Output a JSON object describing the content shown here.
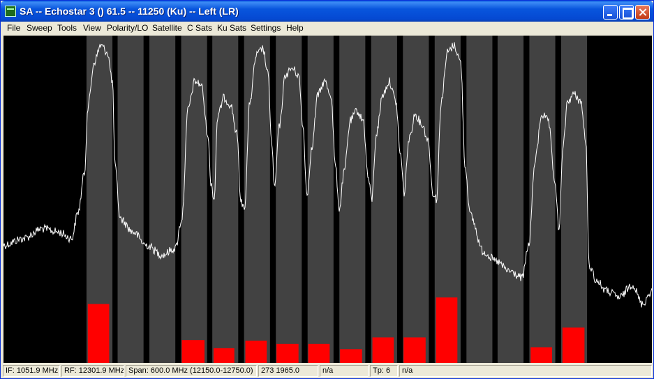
{
  "window": {
    "title": "SA -- Echostar 3 () 61.5 -- 11250 (Ku) -- Left (LR)"
  },
  "menu": [
    "File",
    "Sweep",
    "Tools",
    "View",
    "Polarity/LO",
    "Satellite",
    "C Sats",
    "Ku Sats",
    "Settings",
    "Help"
  ],
  "status": {
    "if": "IF: 1051.9 MHz",
    "rf": "RF: 12301.9 MHz",
    "span": "Span: 600.0 MHz (12150.0-12750.0)",
    "coord": "273 1965.0",
    "field5": "n/a",
    "tp": "Tp: 6",
    "field7": "n/a"
  },
  "colors": {
    "background": "#000000",
    "channel_band": "#424242",
    "trace": "#ffffff",
    "level_bar": "#ff0000"
  },
  "chart_data": {
    "type": "line",
    "title": "",
    "xlabel": "",
    "ylabel": "",
    "x_range_mhz": [
      12150.0,
      12750.0
    ],
    "y_range": [
      0,
      1
    ],
    "trace": [
      [
        0.0,
        0.36
      ],
      [
        0.03,
        0.38
      ],
      [
        0.06,
        0.41
      ],
      [
        0.085,
        0.4
      ],
      [
        0.105,
        0.38
      ],
      [
        0.115,
        0.46
      ],
      [
        0.125,
        0.58
      ],
      [
        0.13,
        0.78
      ],
      [
        0.14,
        0.92
      ],
      [
        0.15,
        0.97
      ],
      [
        0.16,
        0.95
      ],
      [
        0.168,
        0.86
      ],
      [
        0.172,
        0.6
      ],
      [
        0.18,
        0.44
      ],
      [
        0.2,
        0.4
      ],
      [
        0.22,
        0.36
      ],
      [
        0.245,
        0.33
      ],
      [
        0.265,
        0.35
      ],
      [
        0.275,
        0.44
      ],
      [
        0.285,
        0.78
      ],
      [
        0.295,
        0.86
      ],
      [
        0.305,
        0.85
      ],
      [
        0.315,
        0.7
      ],
      [
        0.32,
        0.55
      ],
      [
        0.325,
        0.5
      ],
      [
        0.33,
        0.75
      ],
      [
        0.34,
        0.81
      ],
      [
        0.35,
        0.79
      ],
      [
        0.36,
        0.7
      ],
      [
        0.366,
        0.49
      ],
      [
        0.372,
        0.48
      ],
      [
        0.38,
        0.8
      ],
      [
        0.39,
        0.94
      ],
      [
        0.4,
        0.96
      ],
      [
        0.408,
        0.88
      ],
      [
        0.414,
        0.66
      ],
      [
        0.418,
        0.53
      ],
      [
        0.425,
        0.72
      ],
      [
        0.435,
        0.88
      ],
      [
        0.445,
        0.9
      ],
      [
        0.455,
        0.88
      ],
      [
        0.462,
        0.72
      ],
      [
        0.468,
        0.51
      ],
      [
        0.475,
        0.65
      ],
      [
        0.485,
        0.82
      ],
      [
        0.495,
        0.86
      ],
      [
        0.505,
        0.82
      ],
      [
        0.512,
        0.6
      ],
      [
        0.518,
        0.47
      ],
      [
        0.525,
        0.58
      ],
      [
        0.535,
        0.74
      ],
      [
        0.545,
        0.77
      ],
      [
        0.555,
        0.74
      ],
      [
        0.562,
        0.57
      ],
      [
        0.568,
        0.5
      ],
      [
        0.575,
        0.7
      ],
      [
        0.585,
        0.82
      ],
      [
        0.595,
        0.86
      ],
      [
        0.605,
        0.8
      ],
      [
        0.612,
        0.64
      ],
      [
        0.618,
        0.52
      ],
      [
        0.625,
        0.68
      ],
      [
        0.635,
        0.76
      ],
      [
        0.645,
        0.73
      ],
      [
        0.655,
        0.68
      ],
      [
        0.662,
        0.52
      ],
      [
        0.668,
        0.5
      ],
      [
        0.675,
        0.8
      ],
      [
        0.685,
        0.95
      ],
      [
        0.695,
        0.97
      ],
      [
        0.705,
        0.92
      ],
      [
        0.712,
        0.6
      ],
      [
        0.72,
        0.45
      ],
      [
        0.74,
        0.34
      ],
      [
        0.76,
        0.31
      ],
      [
        0.78,
        0.28
      ],
      [
        0.8,
        0.26
      ],
      [
        0.81,
        0.36
      ],
      [
        0.82,
        0.62
      ],
      [
        0.83,
        0.76
      ],
      [
        0.84,
        0.74
      ],
      [
        0.85,
        0.56
      ],
      [
        0.857,
        0.4
      ],
      [
        0.862,
        0.64
      ],
      [
        0.87,
        0.8
      ],
      [
        0.88,
        0.82
      ],
      [
        0.89,
        0.8
      ],
      [
        0.898,
        0.68
      ],
      [
        0.903,
        0.3
      ],
      [
        0.915,
        0.25
      ],
      [
        0.93,
        0.22
      ],
      [
        0.95,
        0.2
      ],
      [
        0.97,
        0.24
      ],
      [
        0.985,
        0.18
      ],
      [
        1.0,
        0.22
      ]
    ],
    "channel_bands": [
      [
        0.128,
        0.168
      ],
      [
        0.176,
        0.216
      ],
      [
        0.225,
        0.265
      ],
      [
        0.274,
        0.314
      ],
      [
        0.322,
        0.362
      ],
      [
        0.371,
        0.411
      ],
      [
        0.42,
        0.46
      ],
      [
        0.469,
        0.509
      ],
      [
        0.518,
        0.558
      ],
      [
        0.567,
        0.607
      ],
      [
        0.616,
        0.656
      ],
      [
        0.665,
        0.705
      ],
      [
        0.714,
        0.754
      ],
      [
        0.762,
        0.802
      ],
      [
        0.811,
        0.851
      ],
      [
        0.86,
        0.9
      ]
    ],
    "level_bars": [
      [
        0.13,
        0.163,
        0.18
      ],
      [
        0.275,
        0.31,
        0.07
      ],
      [
        0.324,
        0.356,
        0.045
      ],
      [
        0.373,
        0.406,
        0.068
      ],
      [
        0.421,
        0.455,
        0.058
      ],
      [
        0.47,
        0.503,
        0.058
      ],
      [
        0.519,
        0.553,
        0.042
      ],
      [
        0.569,
        0.602,
        0.078
      ],
      [
        0.617,
        0.651,
        0.078
      ],
      [
        0.667,
        0.7,
        0.2
      ],
      [
        0.813,
        0.846,
        0.048
      ],
      [
        0.862,
        0.896,
        0.108
      ]
    ]
  }
}
